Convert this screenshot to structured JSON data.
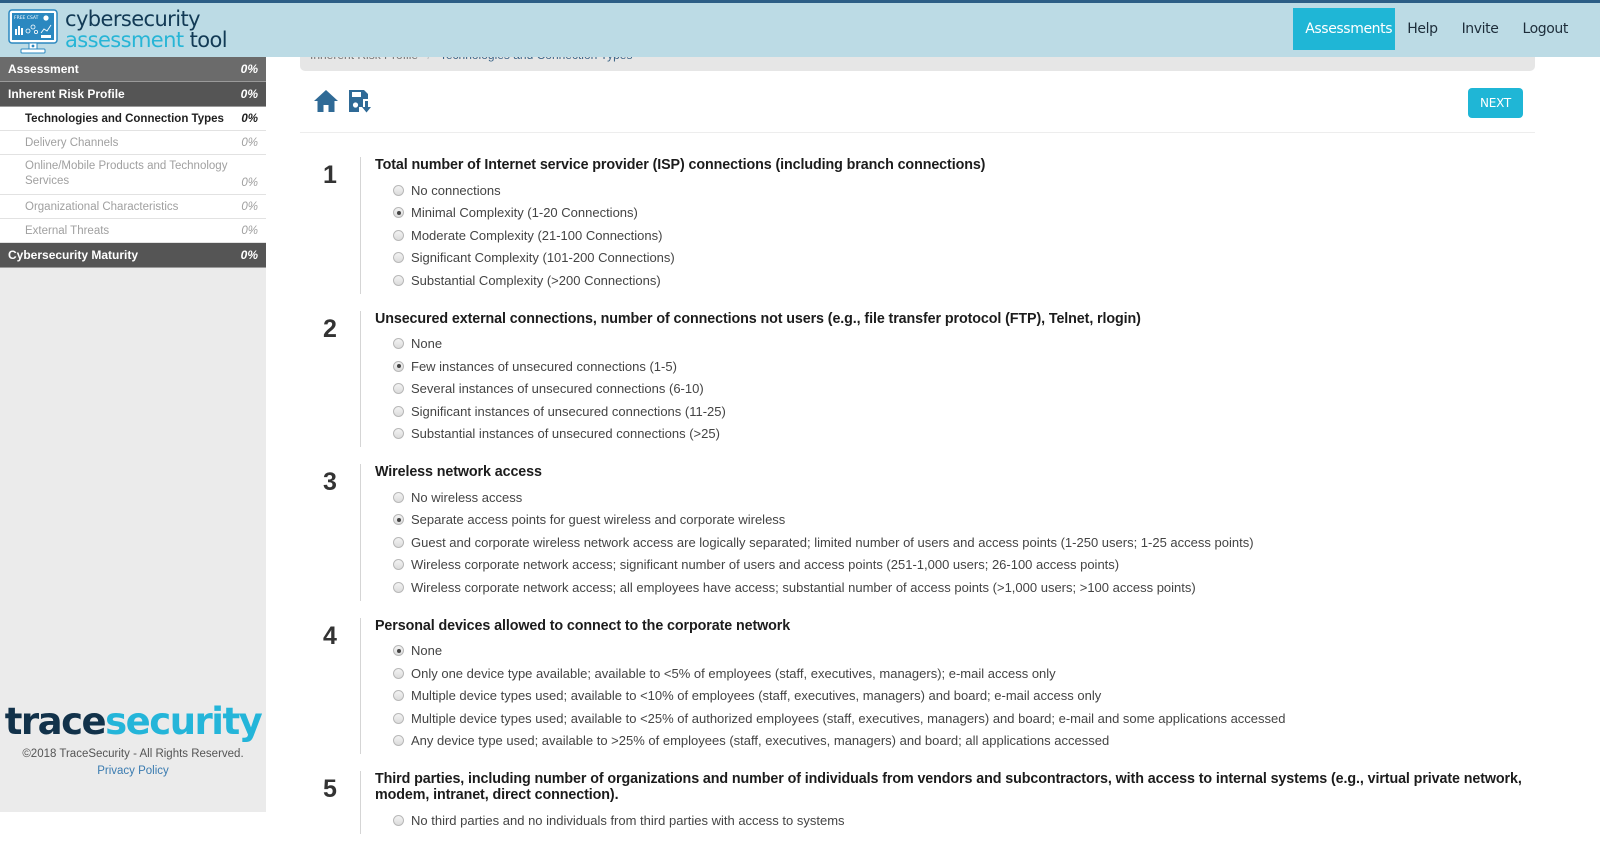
{
  "header": {
    "logo_line1": "cybersecurity",
    "logo_line2_a": "assessment",
    "logo_line2_b": "tool",
    "logo_badge": "FREE CSAT",
    "nav": [
      {
        "label": "Assessments",
        "active": true
      },
      {
        "label": "Help",
        "active": false
      },
      {
        "label": "Invite",
        "active": false
      },
      {
        "label": "Logout",
        "active": false
      }
    ]
  },
  "sidebar": {
    "items": [
      {
        "label": "Assessment",
        "pct": "0%",
        "type": "section"
      },
      {
        "label": "Inherent Risk Profile",
        "pct": "0%",
        "type": "section"
      },
      {
        "label": "Technologies and Connection Types",
        "pct": "0%",
        "type": "sub",
        "active": true
      },
      {
        "label": "Delivery Channels",
        "pct": "0%",
        "type": "sub"
      },
      {
        "label": "Online/Mobile Products and Technology Services",
        "pct": "0%",
        "type": "sub"
      },
      {
        "label": "Organizational Characteristics",
        "pct": "0%",
        "type": "sub"
      },
      {
        "label": "External Threats",
        "pct": "0%",
        "type": "sub"
      },
      {
        "label": "Cybersecurity Maturity",
        "pct": "0%",
        "type": "section"
      }
    ],
    "brand_a": "trace",
    "brand_b": "security",
    "copyright": "©2018 TraceSecurity - All Rights Reserved.",
    "privacy": "Privacy Policy"
  },
  "breadcrumb": {
    "parent": "Inherent Risk Profile",
    "separator": "/",
    "current": "Technologies and Connection Types"
  },
  "toolbar": {
    "home_icon": "home-icon",
    "save_icon": "save-download-icon",
    "next_label": "NEXT"
  },
  "colors": {
    "accent": "#1fb6d6",
    "header_bg": "#bcdbe5",
    "brand_dark": "#12324a"
  },
  "questions": [
    {
      "num": "1",
      "title": "Total number of Internet service provider (ISP) connections (including branch connections)",
      "selected": 1,
      "options": [
        "No connections",
        "Minimal Complexity (1-20 Connections)",
        "Moderate Complexity (21-100 Connections)",
        "Significant Complexity (101-200 Connections)",
        "Substantial Complexity (>200 Connections)"
      ]
    },
    {
      "num": "2",
      "title": "Unsecured external connections, number of connections not users (e.g., file transfer protocol (FTP), Telnet, rlogin)",
      "selected": 1,
      "options": [
        "None",
        "Few instances of unsecured connections (1-5)",
        "Several instances of unsecured connections (6-10)",
        "Significant instances of unsecured connections (11-25)",
        "Substantial instances of unsecured connections (>25)"
      ]
    },
    {
      "num": "3",
      "title": "Wireless network access",
      "selected": 1,
      "options": [
        "No wireless access",
        "Separate access points for guest wireless and corporate wireless",
        "Guest and corporate wireless network access are logically separated; limited number of users and access points (1-250 users; 1-25 access points)",
        "Wireless corporate network access; significant number of users and access points (251-1,000 users; 26-100 access points)",
        "Wireless corporate network access; all employees have access; substantial number of access points (>1,000 users; >100 access points)"
      ]
    },
    {
      "num": "4",
      "title": "Personal devices allowed to connect to the corporate network",
      "selected": 0,
      "options": [
        "None",
        "Only one device type available; available to <5% of employees (staff, executives, managers); e-mail access only",
        "Multiple device types used; available to <10% of employees (staff, executives, managers) and board; e-mail access only",
        "Multiple device types used; available to <25% of authorized employees (staff, executives, managers) and board; e-mail and some applications accessed",
        "Any device type used; available to >25% of employees (staff, executives, managers) and board; all applications accessed"
      ]
    },
    {
      "num": "5",
      "title": "Third parties, including number of organizations and number of individuals from vendors and subcontractors, with access to internal systems (e.g., virtual private network, modem, intranet, direct connection).",
      "selected": -1,
      "options": [
        "No third parties and no individuals from third parties with access to systems"
      ]
    }
  ]
}
